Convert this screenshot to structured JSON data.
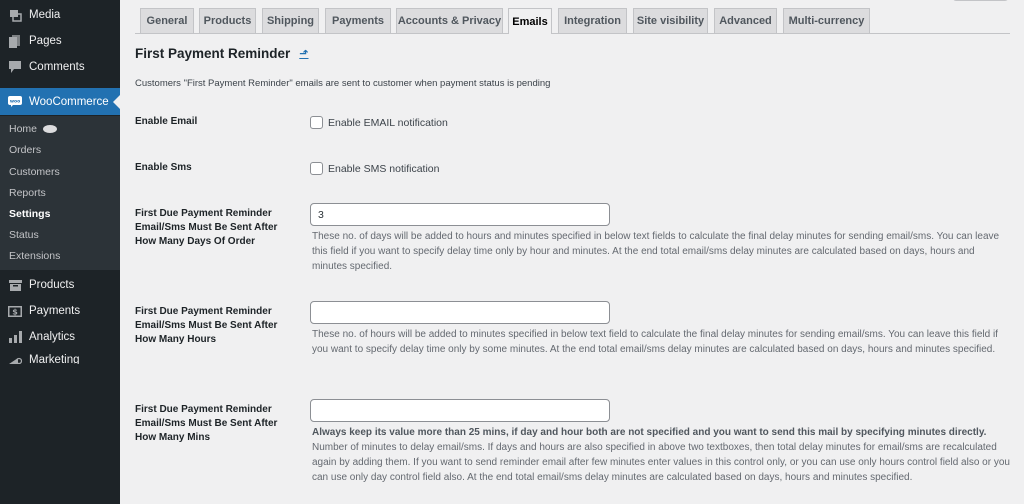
{
  "sidebar": {
    "top_items": [
      {
        "label": "Media",
        "icon": "media-icon"
      },
      {
        "label": "Pages",
        "icon": "pages-icon"
      },
      {
        "label": "Comments",
        "icon": "comments-icon"
      }
    ],
    "active_item": {
      "label": "WooCommerce",
      "icon": "woocommerce-icon"
    },
    "submenu": [
      {
        "label": "Home"
      },
      {
        "label": "Orders"
      },
      {
        "label": "Customers"
      },
      {
        "label": "Reports"
      },
      {
        "label": "Settings",
        "current": true
      },
      {
        "label": "Status"
      },
      {
        "label": "Extensions"
      }
    ],
    "bottom_items": [
      {
        "label": "Products",
        "icon": "products-icon"
      },
      {
        "label": "Payments",
        "icon": "payments-icon"
      },
      {
        "label": "Analytics",
        "icon": "analytics-icon"
      },
      {
        "label": "Marketing",
        "icon": "marketing-icon"
      }
    ]
  },
  "tabs": [
    {
      "label": "General"
    },
    {
      "label": "Products"
    },
    {
      "label": "Shipping"
    },
    {
      "label": "Payments"
    },
    {
      "label": "Accounts & Privacy"
    },
    {
      "label": "Emails",
      "active": true
    },
    {
      "label": "Integration"
    },
    {
      "label": "Site visibility"
    },
    {
      "label": "Advanced"
    },
    {
      "label": "Multi-currency"
    }
  ],
  "page": {
    "title": "First Payment Reminder",
    "title_link_icon": "up-arrow-icon",
    "description": "Customers \"First Payment Reminder\" emails are sent to customer when payment status is pending"
  },
  "fields": {
    "enable_email": {
      "label": "Enable Email",
      "checkbox_label": "Enable EMAIL notification",
      "checked": false
    },
    "enable_sms": {
      "label": "Enable Sms",
      "checkbox_label": "Enable SMS notification",
      "checked": false
    },
    "days": {
      "label": "First Due Payment Reminder Email/Sms Must Be Sent After How Many Days Of Order",
      "value": "3",
      "help": "These no. of days will be added to hours and minutes specified in below text fields to calculate the final delay minutes for sending email/sms. You can leave this field if you want to specify delay time only by hour and minutes. At the end total email/sms delay minutes are calculated based on days, hours and minutes specified."
    },
    "hours": {
      "label": "First Due Payment Reminder Email/Sms Must Be Sent After How Many Hours",
      "value": "",
      "help": "These no. of hours will be added to minutes specified in below text field to calculate the final delay minutes for sending email/sms. You can leave this field if you want to specify delay time only by some minutes. At the end total email/sms delay minutes are calculated based on days, hours and minutes specified."
    },
    "mins": {
      "label": "First Due Payment Reminder Email/Sms Must Be Sent After How Many Mins",
      "value": "",
      "help_bold": "Always keep its value more than 25 mins, if day and hour both are not specified and you want to send this mail by specifying minutes directly.",
      "help": "Number of minutes to delay email/sms. If days and hours are also specified in above two textboxes, then total delay minutes for email/sms are recalculated again by adding them. If you want to send reminder email after few minutes enter values in this control only, or you can use only hours control field also or you can use only day control field also. At the end total email/sms delay minutes are calculated based on days, hours and minutes specified."
    }
  }
}
